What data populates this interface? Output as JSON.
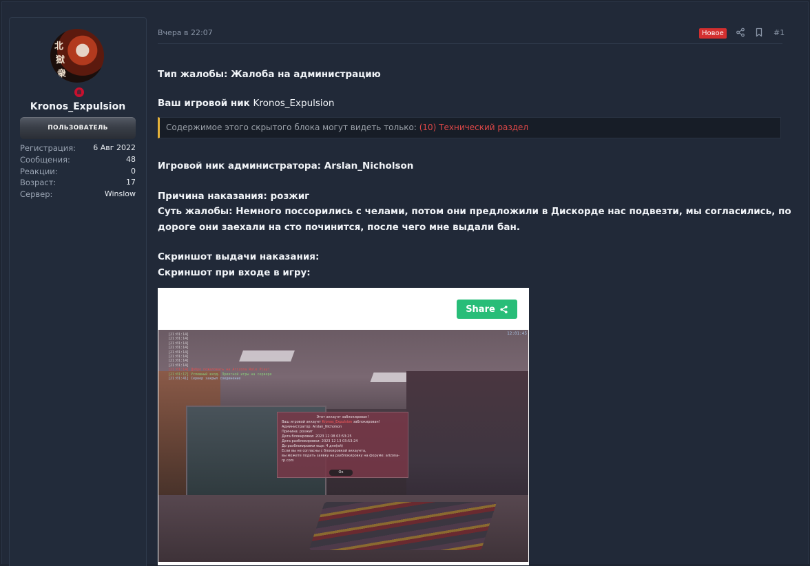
{
  "user": {
    "username": "Kronos_Expulsion",
    "role": "ПОЛЬЗОВАТЕЛЬ",
    "avatar_glyphs": [
      "北",
      "獄",
      "衆"
    ],
    "stats": [
      {
        "label": "Регистрация:",
        "value": "6 Авг 2022"
      },
      {
        "label": "Сообщения:",
        "value": "48"
      },
      {
        "label": "Реакции:",
        "value": "0"
      },
      {
        "label": "Возраст:",
        "value": "17"
      },
      {
        "label": "Сервер:",
        "value": "Winslow"
      }
    ]
  },
  "post": {
    "date": "Вчера в 22:07",
    "new_badge": "Новое",
    "number": "#1",
    "complaint_type": "Тип жалобы: Жалоба на администрацию",
    "nick_label": "Ваш игровой ник",
    "nick_value": "Kronos_Expulsion",
    "hidden_text": "Содержимое этого скрытого блока могут видеть только:",
    "hidden_group": "(10) Технический раздел",
    "admin_nick": "Игровой ник администратора: Arslan_Nicholson",
    "reason": "Причина наказания: розжиг",
    "essence_line1": "Суть жалобы: Немного поссорились с челами, потом они предложили в Дискорде нас подвезти, мы согласились, по",
    "essence_line2": "дороге они заехали на сто починится, после чего мне выдали бан.",
    "screenshot_punishment": "Скриншот выдачи наказания:",
    "screenshot_login": "Скриншот при входе в игру:"
  },
  "embed": {
    "share_label": "Share"
  },
  "game_screenshot": {
    "clock": "12:01:45",
    "chat": [
      "[21:01:14]",
      "[21:01:14]",
      "[21:01:14]",
      "[21:01:14]",
      "[21:01:14]",
      "[21:01:14]",
      "[21:01:14]",
      "[21:01:14]"
    ],
    "chat_red": "[21:01:14] Добро пожаловать на Arizona Role Play!",
    "chat_green": "[21:01:17] Успешный вход. Приятной игры на сервере",
    "chat_blue": "[21:01:41] Сервер закрыл соединение",
    "dialog_title": "Этот аккаунт заблокирован!",
    "dialog_nick_prefix": "Ваш игровой аккаунт",
    "dialog_nick_red": "Kronos_Expulsion",
    "dialog_nick_suffix": "заблокирован!",
    "dialog_admin": "Администратор: Arslan_Nicholson",
    "dialog_reason": "Причина: розжиг",
    "dialog_block_date": "Дата блокировки: 2023 12 08 03:53:25",
    "dialog_unblock_date": "Дата разблокировки: 2023 12 13 03:53:24",
    "dialog_left": "До разблокировки еще: 4 дня(ей)",
    "dialog_note1": "Если вы не согласны с блокировкой аккаунта,",
    "dialog_note2": "вы можете подать заявку на разблокировку на форуме: arizona-rp.com",
    "dialog_ok": "Ок"
  },
  "colors": {
    "new_badge": "#d32f2f",
    "share_button": "#28bd78",
    "hidden_group": "#e04848",
    "hidden_border": "#e5b23a",
    "online_dot": "#c8102e"
  },
  "icons": [
    "share-icon",
    "bookmark-icon",
    "share-alt-icon",
    "user-icon"
  ]
}
